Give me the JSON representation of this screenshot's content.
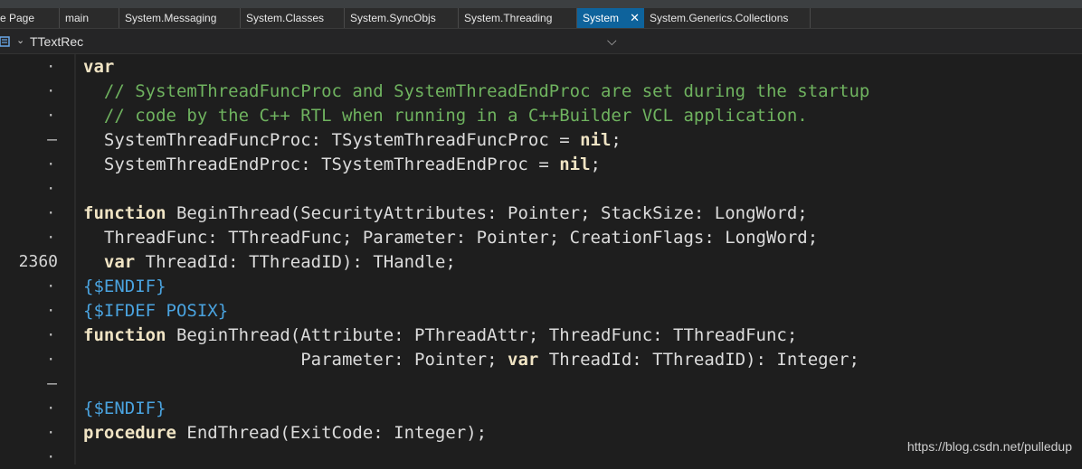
{
  "tabs": [
    {
      "label": "e Page"
    },
    {
      "label": "main"
    },
    {
      "label": "System.Messaging"
    },
    {
      "label": "System.Classes"
    },
    {
      "label": "System.SyncObjs"
    },
    {
      "label": "System.Threading"
    },
    {
      "label": "System",
      "active": true
    },
    {
      "label": "System.Generics.Collections"
    }
  ],
  "breadcrumb": {
    "text": "TTextRec"
  },
  "gutter": {
    "line_number": "2360"
  },
  "code": {
    "l1": "var",
    "l2": "  // SystemThreadFuncProc and SystemThreadEndProc are set during the startup",
    "l3": "  // code by the C++ RTL when running in a C++Builder VCL application.",
    "l4_a": "  SystemThreadFuncProc: TSystemThreadFuncProc = ",
    "l4_b": "nil",
    "l4_c": ";",
    "l5_a": "  SystemThreadEndProc: TSystemThreadEndProc = ",
    "l5_b": "nil",
    "l5_c": ";",
    "l7_a": "function",
    "l7_b": " BeginThread(SecurityAttributes: Pointer; StackSize: LongWord;",
    "l8": "  ThreadFunc: TThreadFunc; Parameter: Pointer; CreationFlags: LongWord;",
    "l9_a": "  ",
    "l9_b": "var",
    "l9_c": " ThreadId: TThreadID): THandle;",
    "l10": "{$ENDIF}",
    "l11": "{$IFDEF POSIX}",
    "l12_a": "function",
    "l12_b": " BeginThread(Attribute: PThreadAttr; ThreadFunc: TThreadFunc;",
    "l13_a": "                     Parameter: Pointer; ",
    "l13_b": "var",
    "l13_c": " ThreadId: TThreadID): Integer;",
    "l15": "{$ENDIF}",
    "l16_a": "procedure",
    "l16_b": " EndThread(ExitCode: Integer);"
  },
  "watermark": "https://blog.csdn.net/pulledup",
  "colors": {
    "active_tab": "#0e639c",
    "comment": "#6fb35f",
    "directive": "#4aa3df",
    "keyword": "#f0e4c4"
  }
}
